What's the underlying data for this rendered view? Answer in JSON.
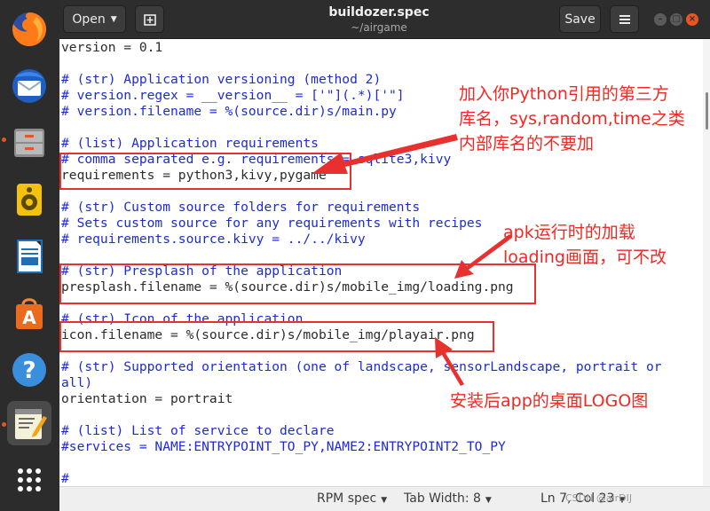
{
  "window": {
    "title": "buildozer.spec",
    "subtitle": "~/airgame",
    "open_label": "Open",
    "save_label": "Save"
  },
  "dock": {
    "items": [
      "firefox-icon",
      "thunderbird-icon",
      "files-icon",
      "rhythmbox-icon",
      "libreoffice-writer-icon",
      "ubuntu-software-icon",
      "help-icon",
      "text-editor-icon",
      "app-grid-icon"
    ]
  },
  "editor": {
    "lines": [
      {
        "text": "version = 0.1",
        "kind": "code"
      },
      {
        "text": "",
        "kind": "code"
      },
      {
        "text": "# (str) Application versioning (method 2)",
        "kind": "comment"
      },
      {
        "text": "# version.regex = __version__ = ['\"](.*)['\"]",
        "kind": "comment"
      },
      {
        "text": "# version.filename = %(source.dir)s/main.py",
        "kind": "comment"
      },
      {
        "text": "",
        "kind": "code"
      },
      {
        "text": "# (list) Application requirements",
        "kind": "comment"
      },
      {
        "text": "# comma separated e.g. requirements = sqlite3,kivy",
        "kind": "comment"
      },
      {
        "text": "requirements = python3,kivy,pygame",
        "kind": "code"
      },
      {
        "text": "",
        "kind": "code"
      },
      {
        "text": "# (str) Custom source folders for requirements",
        "kind": "comment"
      },
      {
        "text": "# Sets custom source for any requirements with recipes",
        "kind": "comment"
      },
      {
        "text": "# requirements.source.kivy = ../../kivy",
        "kind": "comment"
      },
      {
        "text": "",
        "kind": "code"
      },
      {
        "text": "# (str) Presplash of the application",
        "kind": "comment"
      },
      {
        "text": "presplash.filename = %(source.dir)s/mobile_img/loading.png",
        "kind": "code"
      },
      {
        "text": "",
        "kind": "code"
      },
      {
        "text": "# (str) Icon of the application",
        "kind": "comment"
      },
      {
        "text": "icon.filename = %(source.dir)s/mobile_img/playair.png",
        "kind": "code"
      },
      {
        "text": "",
        "kind": "code"
      },
      {
        "text": "# (str) Supported orientation (one of landscape, sensorLandscape, portrait or",
        "kind": "comment"
      },
      {
        "text": "all)",
        "kind": "comment"
      },
      {
        "text": "orientation = portrait",
        "kind": "code"
      },
      {
        "text": "",
        "kind": "code"
      },
      {
        "text": "# (list) List of service to declare",
        "kind": "comment"
      },
      {
        "text": "#services = NAME:ENTRYPOINT_TO_PY,NAME2:ENTRYPOINT2_TO_PY",
        "kind": "comment"
      },
      {
        "text": "",
        "kind": "code"
      },
      {
        "text": "#",
        "kind": "comment"
      }
    ]
  },
  "annotations": {
    "requirements_note_line1": "加入你Python引用的第三方",
    "requirements_note_line2": "库名，sys,random,time之类",
    "requirements_note_line3": "内部库名的不要加",
    "presplash_note_line1": "apk运行时的加载",
    "presplash_note_line2": "loading画面，可不改",
    "icon_note": "安装后app的桌面LOGO图"
  },
  "statusbar": {
    "language": "RPM spec",
    "tab_width": "Tab Width: 8",
    "position": "Ln 7, Col 23",
    "watermark": "CSDN @airDIJ"
  },
  "colors": {
    "annotation_red": "#e8312f",
    "comment_blue": "#1c2bd6",
    "ubuntu_orange": "#e95420"
  }
}
